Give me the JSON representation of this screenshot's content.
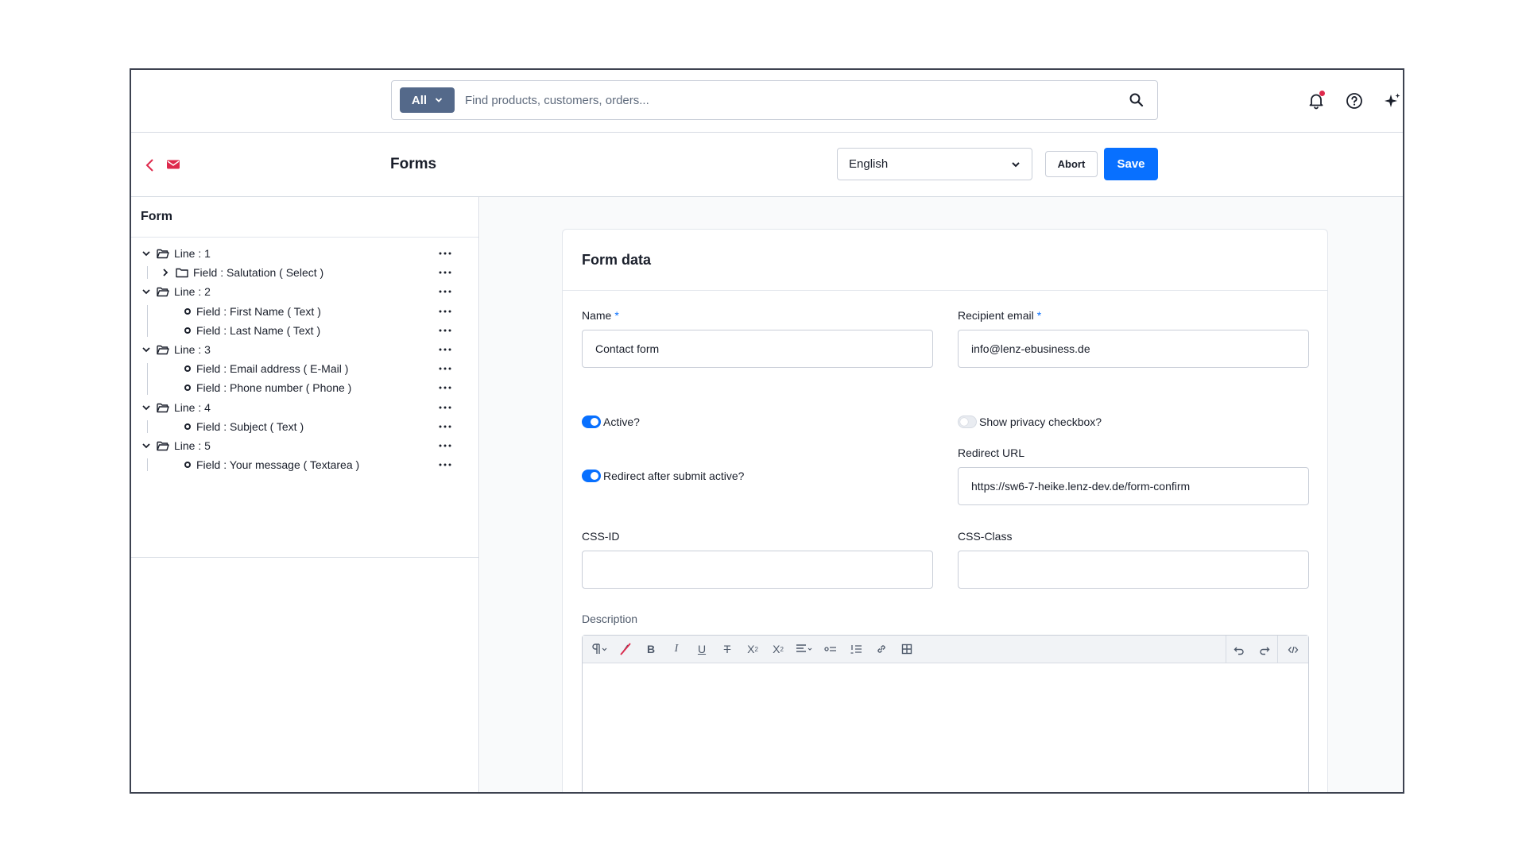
{
  "search": {
    "scope_label": "All",
    "placeholder": "Find products, customers, orders..."
  },
  "header": {
    "title": "Forms",
    "language": "English",
    "abort_label": "Abort",
    "save_label": "Save"
  },
  "tree": {
    "title": "Form",
    "items": [
      {
        "label": "Line : 1",
        "kind": "line"
      },
      {
        "label": "Field : Salutation ( Select )",
        "kind": "group"
      },
      {
        "label": "Line : 2",
        "kind": "line"
      },
      {
        "label": "Field : First Name ( Text )",
        "kind": "field"
      },
      {
        "label": "Field : Last Name ( Text )",
        "kind": "field"
      },
      {
        "label": "Line : 3",
        "kind": "line"
      },
      {
        "label": "Field : Email address ( E-Mail )",
        "kind": "field"
      },
      {
        "label": "Field : Phone number ( Phone )",
        "kind": "field"
      },
      {
        "label": "Line : 4",
        "kind": "line"
      },
      {
        "label": "Field : Subject ( Text )",
        "kind": "field"
      },
      {
        "label": "Line : 5",
        "kind": "line"
      },
      {
        "label": "Field : Your message ( Textarea )",
        "kind": "field"
      }
    ]
  },
  "form": {
    "title": "Form data",
    "name_label": "Name",
    "name_value": "Contact form",
    "recipient_label": "Recipient email",
    "recipient_value": "info@lenz-ebusiness.de",
    "required_mark": "*",
    "active_label": "Active?",
    "active_on": true,
    "privacy_label": "Show privacy checkbox?",
    "privacy_on": false,
    "redirect_toggle_label": "Redirect after submit active?",
    "redirect_on": true,
    "redirect_url_label": "Redirect URL",
    "redirect_url_value": "https://sw6-7-heike.lenz-dev.de/form-confirm",
    "css_id_label": "CSS-ID",
    "css_id_value": "",
    "css_class_label": "CSS-Class",
    "css_class_value": "",
    "description_label": "Description"
  },
  "colors": {
    "primary": "#0870ff",
    "accent_red": "#de294c",
    "scope_button": "#54698a"
  }
}
